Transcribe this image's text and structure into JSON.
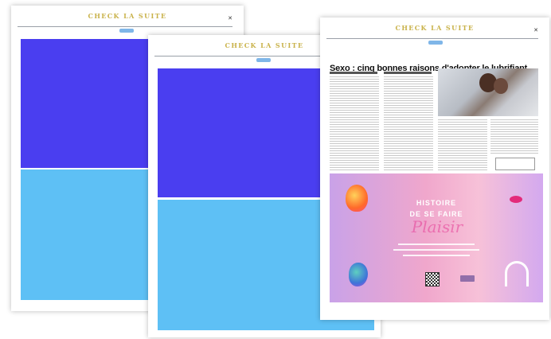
{
  "masthead": "CHECK LA SUITE",
  "headline": "Sexo : cinq bonnes raisons d'adopter le lubrifiant",
  "ad": {
    "line1": "HISTOIRE",
    "line2": "DE SE FAIRE",
    "swash": "Plaisir"
  },
  "colors": {
    "block_dark": "#4a3ef0",
    "block_light": "#5ec0f5",
    "masthead": "#c9b24a"
  }
}
